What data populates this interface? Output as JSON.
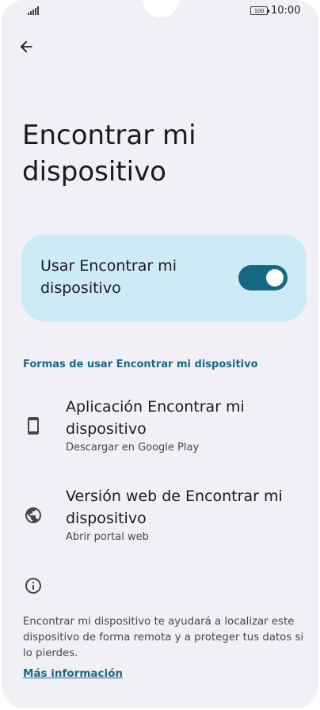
{
  "status_bar": {
    "battery": "100",
    "time": "10:00"
  },
  "header": {
    "back_icon": "arrow-left-icon",
    "title": "Encontrar mi dispositivo"
  },
  "main_toggle": {
    "label": "Usar Encontrar mi dispositivo",
    "on": true,
    "accent_color": "#156882",
    "card_color": "#cdeaf7"
  },
  "section": {
    "header": "Formas de usar Encontrar mi dispositivo",
    "items": [
      {
        "icon": "smartphone-icon",
        "title": "Aplicación Encontrar mi dispositivo",
        "subtitle": "Descargar en Google Play"
      },
      {
        "icon": "globe-icon",
        "title": "Versión web de Encontrar mi dispositivo",
        "subtitle": "Abrir portal web"
      }
    ]
  },
  "info": {
    "icon": "info-icon",
    "text": "Encontrar mi dispositivo te ayudará a localizar este dispositivo de forma remota y a proteger tus datos si lo pierdes.",
    "link": "Más información"
  }
}
